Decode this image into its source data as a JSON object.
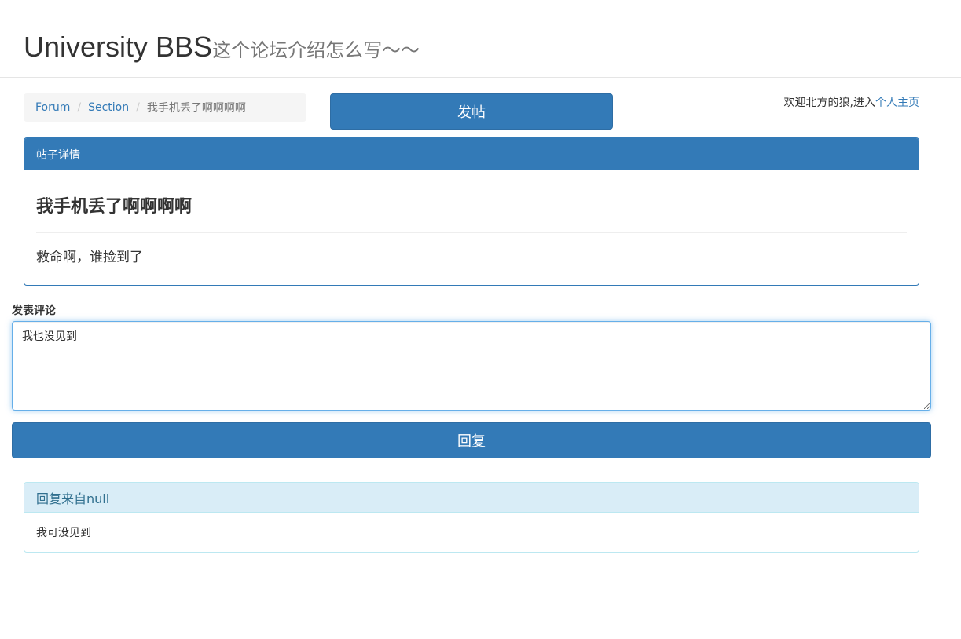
{
  "header": {
    "title": "University BBS",
    "subtitle": "这个论坛介绍怎么写～～"
  },
  "breadcrumb": {
    "items": [
      "Forum",
      "Section"
    ],
    "active": "我手机丢了啊啊啊啊"
  },
  "toolbar": {
    "post_label": "发帖"
  },
  "user": {
    "welcome": "欢迎北方的狼,进入",
    "profile_link": "个人主页"
  },
  "post": {
    "panel_title": "帖子详情",
    "title": "我手机丢了啊啊啊啊",
    "content": "救命啊，谁捡到了"
  },
  "comment": {
    "label": "发表评论",
    "value": "我也没见到",
    "submit_label": "回复"
  },
  "replies": [
    {
      "heading": "回复来自null",
      "content": "我可没见到"
    }
  ],
  "colors": {
    "primary": "#337ab7",
    "info_bg": "#d9edf7",
    "info_text": "#31708f",
    "breadcrumb_bg": "#f5f5f5"
  }
}
